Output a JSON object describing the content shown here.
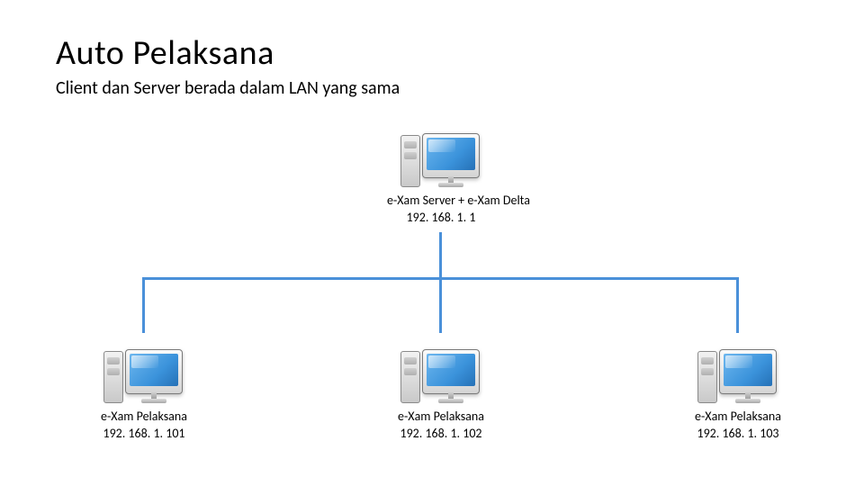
{
  "title": "Auto Pelaksana",
  "subtitle": "Client dan Server berada dalam LAN yang sama",
  "server": {
    "label": "e-Xam Server + e-Xam Delta",
    "ip": "192. 168. 1. 1"
  },
  "clients": [
    {
      "label": "e-Xam Pelaksana",
      "ip": "192. 168. 1. 101"
    },
    {
      "label": "e-Xam Pelaksana",
      "ip": "192. 168. 1. 102"
    },
    {
      "label": "e-Xam Pelaksana",
      "ip": "192. 168. 1. 103"
    }
  ],
  "chart_data": {
    "type": "tree",
    "root": {
      "name": "e-Xam Server + e-Xam Delta",
      "ip": "192.168.1.1"
    },
    "children": [
      {
        "name": "e-Xam Pelaksana",
        "ip": "192.168.1.101"
      },
      {
        "name": "e-Xam Pelaksana",
        "ip": "192.168.1.102"
      },
      {
        "name": "e-Xam Pelaksana",
        "ip": "192.168.1.103"
      }
    ],
    "connector_color": "#4a90d9"
  }
}
